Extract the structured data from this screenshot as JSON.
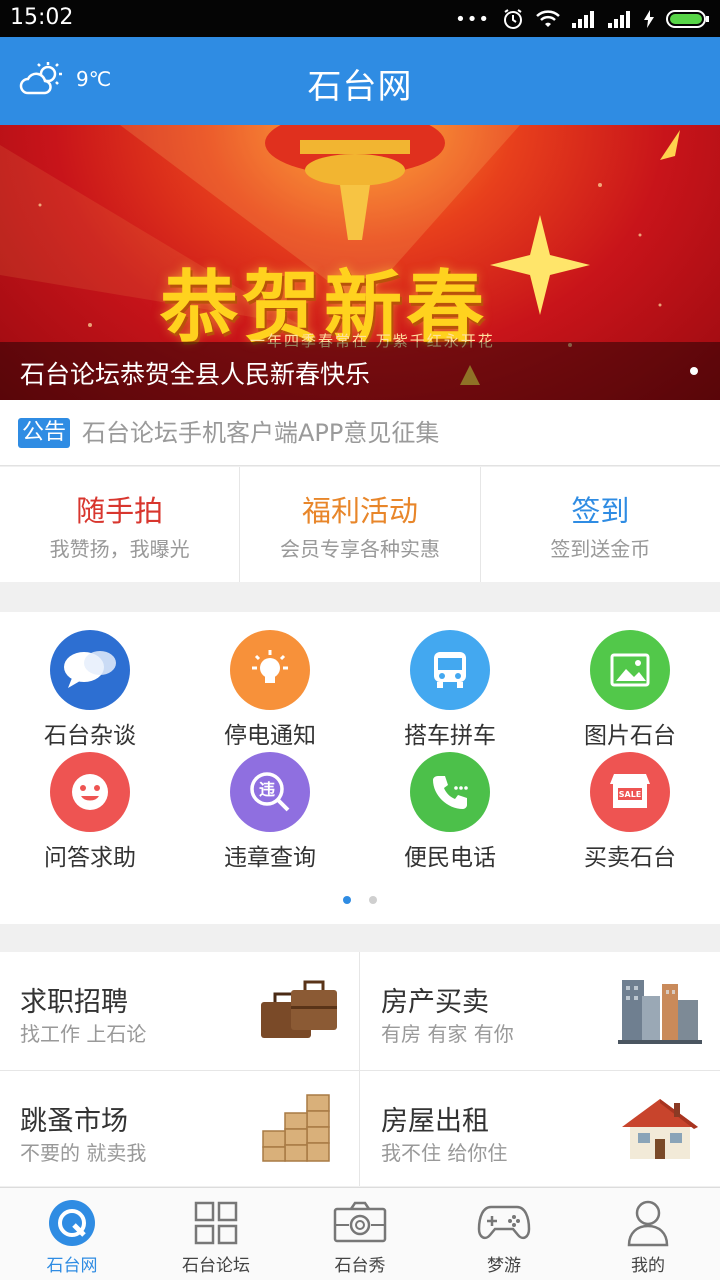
{
  "status_bar": {
    "time": "15:02"
  },
  "header": {
    "temperature": "9℃",
    "title": "石台网"
  },
  "banner": {
    "headline": "恭贺新春",
    "subline": "一年四季春常在  万紫千红永开花",
    "caption": "石台论坛恭贺全县人民新春快乐"
  },
  "notice": {
    "badge": "公告",
    "text": "石台论坛手机客户端APP意见征集"
  },
  "quick_actions": [
    {
      "title": "随手拍",
      "subtitle": "我赞扬，我曝光",
      "color": "#d8362e"
    },
    {
      "title": "福利活动",
      "subtitle": "会员专享各种实惠",
      "color": "#e8862a"
    },
    {
      "title": "签到",
      "subtitle": "签到送金币",
      "color": "#2f8ce3"
    }
  ],
  "grid": [
    {
      "label": "石台杂谈",
      "icon": "chat-bubbles-icon",
      "color": "#2d6fd2"
    },
    {
      "label": "停电通知",
      "icon": "lightbulb-icon",
      "color": "#f7913a"
    },
    {
      "label": "搭车拼车",
      "icon": "bus-icon",
      "color": "#43a8f0"
    },
    {
      "label": "图片石台",
      "icon": "picture-icon",
      "color": "#52c84a"
    },
    {
      "label": "问答求助",
      "icon": "smiley-icon",
      "color": "#ee5452"
    },
    {
      "label": "违章查询",
      "icon": "violation-search-icon",
      "color": "#8f6fe0"
    },
    {
      "label": "便民电话",
      "icon": "phone-icon",
      "color": "#4cc04a"
    },
    {
      "label": "买卖石台",
      "icon": "shop-icon",
      "color": "#ee5452"
    }
  ],
  "grid_icon_texts": {
    "violation": "违",
    "sale": "SALE"
  },
  "tiles": [
    {
      "title": "求职招聘",
      "subtitle": "找工作 上石论",
      "icon": "briefcase-icon"
    },
    {
      "title": "房产买卖",
      "subtitle": "有房 有家 有你",
      "icon": "buildings-icon"
    },
    {
      "title": "跳蚤市场",
      "subtitle": "不要的 就卖我",
      "icon": "boxes-icon"
    },
    {
      "title": "房屋出租",
      "subtitle": "我不住 给你住",
      "icon": "house-icon"
    }
  ],
  "tabbar": [
    {
      "label": "石台网",
      "icon": "home-logo-icon",
      "active": true
    },
    {
      "label": "石台论坛",
      "icon": "grid-icon",
      "active": false
    },
    {
      "label": "石台秀",
      "icon": "camera-icon",
      "active": false
    },
    {
      "label": "梦游",
      "icon": "gamepad-icon",
      "active": false
    },
    {
      "label": "我的",
      "icon": "user-icon",
      "active": false
    }
  ]
}
